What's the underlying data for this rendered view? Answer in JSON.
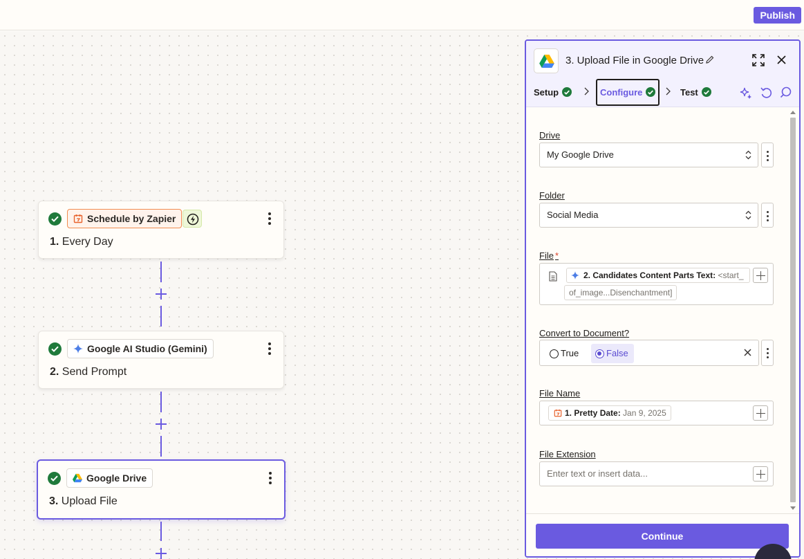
{
  "topbar": {
    "publish_label": "Publish"
  },
  "workflow": {
    "steps": [
      {
        "app": "Schedule by Zapier",
        "number": "1.",
        "title": "Every Day"
      },
      {
        "app": "Google AI Studio (Gemini)",
        "number": "2.",
        "title": "Send Prompt"
      },
      {
        "app": "Google Drive",
        "number": "3.",
        "title": "Upload File"
      }
    ]
  },
  "panel": {
    "title": "3. Upload File in Google Drive",
    "tabs": {
      "setup": "Setup",
      "configure": "Configure",
      "test": "Test"
    },
    "fields": {
      "drive": {
        "label": "Drive",
        "value": "My Google Drive"
      },
      "folder": {
        "label": "Folder",
        "value": "Social Media"
      },
      "file": {
        "label": "File",
        "required_mark": "*",
        "pill_label": "2. Candidates Content Parts Text:",
        "pill_value_start": "<start_",
        "pill_value_cont": "of_image...Disenchantment]"
      },
      "convert": {
        "label": "Convert to Document?",
        "option_true": "True",
        "option_false": "False",
        "selected": "False"
      },
      "file_name": {
        "label": "File Name",
        "pill_label": "1. Pretty Date:",
        "pill_value": "Jan 9, 2025"
      },
      "file_extension": {
        "label": "File Extension",
        "placeholder": "Enter text or insert data..."
      }
    },
    "continue_label": "Continue"
  },
  "colors": {
    "accent": "#6a5ae0",
    "success": "#1f7a3b",
    "schedule_orange": "#f28b4f"
  }
}
